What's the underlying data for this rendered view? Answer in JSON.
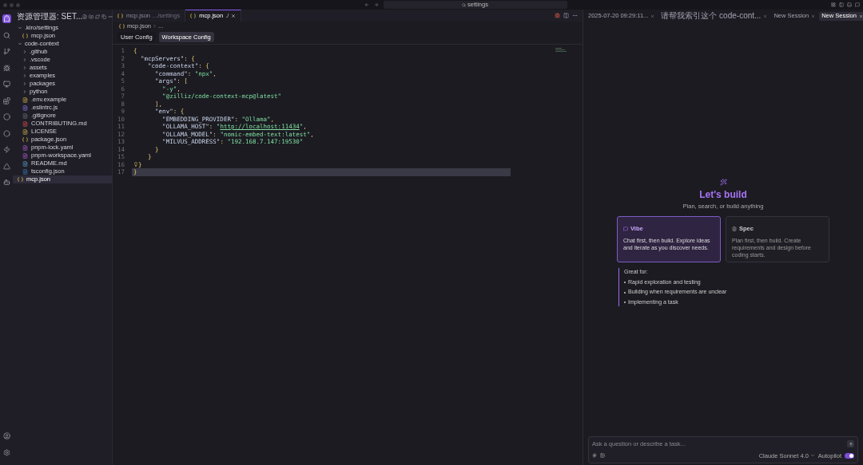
{
  "titlebar": {
    "search": "settings"
  },
  "explorer": {
    "title": "资源管理器: SET...",
    "tree": [
      {
        "label": ".kiro/settings",
        "kind": "folder",
        "expanded": true,
        "selected": false,
        "children": [
          {
            "label": "mcp.json",
            "kind": "json",
            "selected": false
          }
        ]
      },
      {
        "label": "code-context",
        "kind": "folder",
        "expanded": true,
        "selected": false,
        "children": [
          {
            "label": ".github",
            "kind": "folder",
            "expanded": false,
            "selected": false
          },
          {
            "label": ".vscode",
            "kind": "folder",
            "expanded": false,
            "selected": false
          },
          {
            "label": "assets",
            "kind": "folder",
            "expanded": false,
            "selected": false
          },
          {
            "label": "examples",
            "kind": "folder",
            "expanded": false,
            "selected": false
          },
          {
            "label": "packages",
            "kind": "folder",
            "expanded": false,
            "selected": false
          },
          {
            "label": "python",
            "kind": "folder",
            "expanded": false,
            "selected": false
          },
          {
            "label": ".env.example",
            "kind": "env",
            "selected": false
          },
          {
            "label": ".eslintrc.js",
            "kind": "eslint",
            "selected": false
          },
          {
            "label": ".gitignore",
            "kind": "git",
            "selected": false
          },
          {
            "label": "CONTRIBUTING.md",
            "kind": "contrib",
            "selected": false
          },
          {
            "label": "LICENSE",
            "kind": "license",
            "selected": false
          },
          {
            "label": "package.json",
            "kind": "json",
            "selected": false
          },
          {
            "label": "pnpm-lock.yaml",
            "kind": "yaml",
            "selected": false
          },
          {
            "label": "pnpm-workspace.yaml",
            "kind": "yaml",
            "selected": false
          },
          {
            "label": "README.md",
            "kind": "readme",
            "selected": false
          },
          {
            "label": "tsconfig.json",
            "kind": "ts",
            "selected": false
          }
        ]
      },
      {
        "label": "mcp.json",
        "kind": "json",
        "selected": true
      }
    ]
  },
  "editor": {
    "tabs": [
      {
        "label": "mcp.json",
        "detail": ".../settings",
        "selected": false
      },
      {
        "label": "mcp.json",
        "detail": "./",
        "selected": true
      }
    ],
    "breadcrumb": {
      "file": "mcp.json",
      "rest": "..."
    },
    "config_tabs": [
      {
        "label": "User Config",
        "selected": false
      },
      {
        "label": "Workspace Config",
        "selected": true
      }
    ],
    "lines": [
      {
        "number": "1",
        "selected": false,
        "bulb": false,
        "tokens": [
          {
            "kind": "punct",
            "text": "{"
          }
        ]
      },
      {
        "number": "2",
        "selected": false,
        "bulb": false,
        "tokens": [
          {
            "kind": "key",
            "text": "  \"mcpServers\""
          },
          {
            "kind": "punct",
            "text": ": {"
          }
        ]
      },
      {
        "number": "3",
        "selected": false,
        "bulb": false,
        "tokens": [
          {
            "kind": "key",
            "text": "    \"code-context\""
          },
          {
            "kind": "punct",
            "text": ": {"
          }
        ]
      },
      {
        "number": "4",
        "selected": false,
        "bulb": false,
        "tokens": [
          {
            "kind": "key",
            "text": "      \"command\""
          },
          {
            "kind": "punct",
            "text": ": "
          },
          {
            "kind": "string",
            "text": "\"npx\""
          },
          {
            "kind": "punct",
            "text": ","
          }
        ]
      },
      {
        "number": "5",
        "selected": false,
        "bulb": false,
        "tokens": [
          {
            "kind": "key",
            "text": "      \"args\""
          },
          {
            "kind": "punct",
            "text": ": ["
          }
        ]
      },
      {
        "number": "6",
        "selected": false,
        "bulb": false,
        "tokens": [
          {
            "kind": "string",
            "text": "        \"-y\""
          },
          {
            "kind": "punct",
            "text": ","
          }
        ]
      },
      {
        "number": "7",
        "selected": false,
        "bulb": false,
        "tokens": [
          {
            "kind": "string",
            "text": "        \"@zilliz/code-context-mcp@latest\""
          }
        ]
      },
      {
        "number": "8",
        "selected": false,
        "bulb": false,
        "tokens": [
          {
            "kind": "punct",
            "text": "      ],"
          }
        ]
      },
      {
        "number": "9",
        "selected": false,
        "bulb": false,
        "tokens": [
          {
            "kind": "key",
            "text": "      \"env\""
          },
          {
            "kind": "punct",
            "text": ": {"
          }
        ]
      },
      {
        "number": "10",
        "selected": false,
        "bulb": false,
        "tokens": [
          {
            "kind": "key",
            "text": "        \"EMBEDDING_PROVIDER\""
          },
          {
            "kind": "punct",
            "text": ": "
          },
          {
            "kind": "string",
            "text": "\"Ollama\""
          },
          {
            "kind": "punct",
            "text": ","
          }
        ]
      },
      {
        "number": "11",
        "selected": false,
        "bulb": false,
        "tokens": [
          {
            "kind": "key",
            "text": "        \"OLLAMA_HOST\""
          },
          {
            "kind": "punct",
            "text": ": "
          },
          {
            "kind": "string",
            "text": "\""
          },
          {
            "kind": "link",
            "text": "http://localhost:11434"
          },
          {
            "kind": "string",
            "text": "\""
          },
          {
            "kind": "punct",
            "text": ","
          }
        ]
      },
      {
        "number": "12",
        "selected": false,
        "bulb": false,
        "tokens": [
          {
            "kind": "key",
            "text": "        \"OLLAMA_MODEL\""
          },
          {
            "kind": "punct",
            "text": ": "
          },
          {
            "kind": "string",
            "text": "\"nomic-embed-text:latest\""
          },
          {
            "kind": "punct",
            "text": ","
          }
        ]
      },
      {
        "number": "13",
        "selected": false,
        "bulb": false,
        "tokens": [
          {
            "kind": "key",
            "text": "        \"MILVUS_ADDRESS\""
          },
          {
            "kind": "punct",
            "text": ": "
          },
          {
            "kind": "string",
            "text": "\"192.168.7.147:19530\""
          }
        ]
      },
      {
        "number": "14",
        "selected": false,
        "bulb": false,
        "tokens": [
          {
            "kind": "punct",
            "text": "      }"
          }
        ]
      },
      {
        "number": "15",
        "selected": false,
        "bulb": false,
        "tokens": [
          {
            "kind": "punct",
            "text": "    }"
          }
        ]
      },
      {
        "number": "16",
        "selected": false,
        "bulb": true,
        "tokens": [
          {
            "kind": "punct",
            "text": "}"
          }
        ]
      },
      {
        "number": "17",
        "selected": true,
        "bulb": false,
        "tokens": [
          {
            "kind": "punct",
            "text": "}"
          }
        ]
      }
    ]
  },
  "agent": {
    "sessions": [
      {
        "label": "2025-07-20 09:29:11...",
        "selected": false
      },
      {
        "label": "请帮我索引这个 code-cont...",
        "selected": false
      },
      {
        "label": "New Session",
        "selected": false
      },
      {
        "label": "New Session",
        "selected": true
      }
    ],
    "title": "Let's build",
    "subtitle": "Plan, search, or build anything",
    "modes": [
      {
        "kind": "vibe",
        "title": "Vibe",
        "description": "Chat first, then build. Explore ideas and iterate as you discover needs.",
        "selected": true
      },
      {
        "kind": "spec",
        "title": "Spec",
        "description": "Plan first, then build. Create requirements and design before coding starts.",
        "selected": false
      }
    ],
    "great_for": {
      "title": "Great for:",
      "items": [
        "Rapid exploration and testing",
        "Building when requirements are unclear",
        "Implementing a task"
      ]
    },
    "chat": {
      "placeholder": "Ask a question or describe a task...",
      "model": "Claude Sonnet 4.0",
      "autopilot": {
        "label": "Autopilot",
        "on": true
      }
    }
  }
}
